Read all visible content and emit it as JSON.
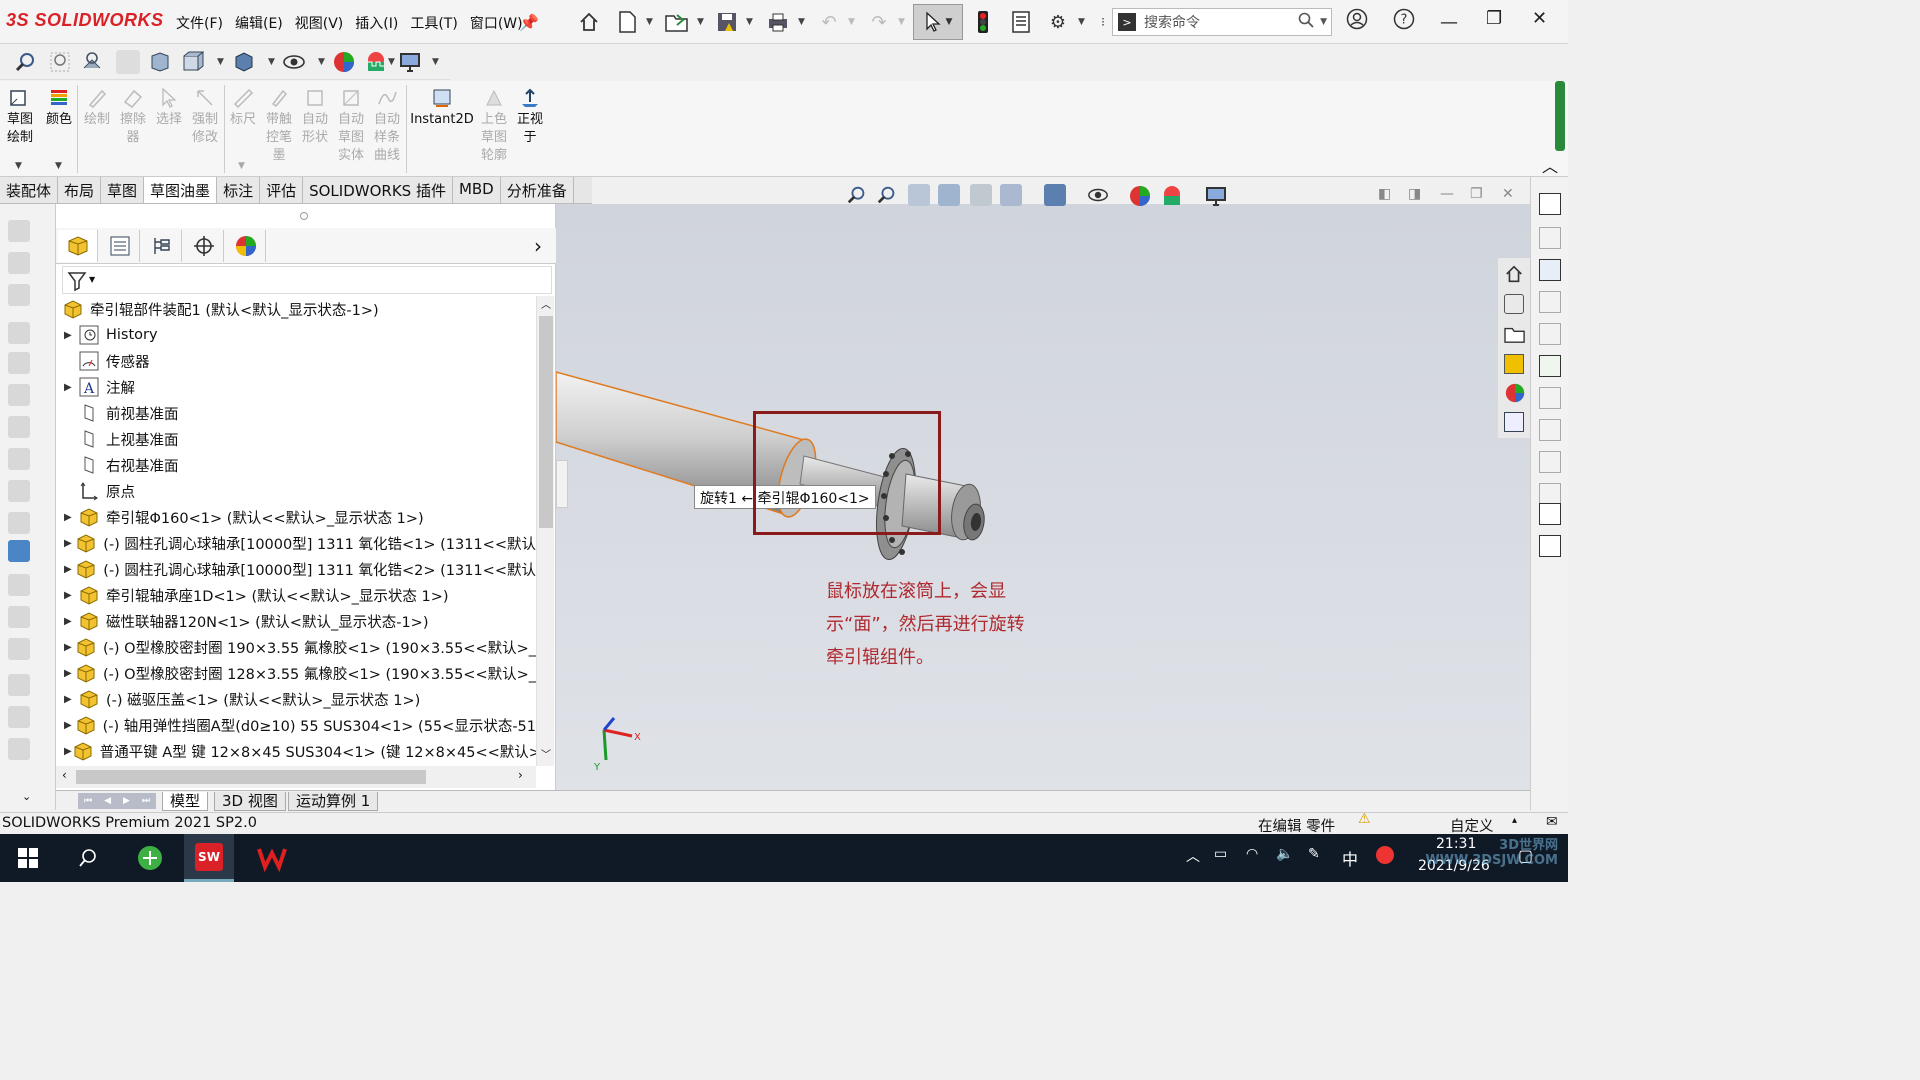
{
  "app": {
    "logo": "3S SOLIDWORKS",
    "brand_color": "#da2128"
  },
  "menu": [
    "文件(F)",
    "编辑(E)",
    "视图(V)",
    "插入(I)",
    "工具(T)",
    "窗口(W)"
  ],
  "search": {
    "placeholder": "搜索命令"
  },
  "command_manager": {
    "items": [
      {
        "label": "草图\n绘制",
        "enabled": true
      },
      {
        "label": "颜色",
        "enabled": true
      },
      {
        "label": "绘制",
        "enabled": false
      },
      {
        "label": "擦除\n器",
        "enabled": false
      },
      {
        "label": "选择",
        "enabled": false
      },
      {
        "label": "强制\n修改",
        "enabled": false
      },
      {
        "label": "标尺",
        "enabled": false
      },
      {
        "label": "带触\n控笔\n墨",
        "enabled": false
      },
      {
        "label": "自动\n形状",
        "enabled": false
      },
      {
        "label": "自动\n草图\n实体",
        "enabled": false
      },
      {
        "label": "自动\n样条\n曲线",
        "enabled": false
      },
      {
        "label": "Instant2D",
        "enabled": true
      },
      {
        "label": "上色\n草图\n轮廓",
        "enabled": false
      },
      {
        "label": "正视\n于",
        "enabled": true
      }
    ]
  },
  "tabs": [
    "装配体",
    "布局",
    "草图",
    "草图油墨",
    "标注",
    "评估",
    "SOLIDWORKS 插件",
    "MBD",
    "分析准备"
  ],
  "active_tab": "草图油墨",
  "feature_tree": {
    "root": "牵引辊部件装配1 (默认<默认_显示状态-1>)",
    "items": [
      {
        "label": "History",
        "expandable": true,
        "icon": "history-icon"
      },
      {
        "label": "传感器",
        "expandable": false,
        "icon": "sensor-icon"
      },
      {
        "label": "注解",
        "expandable": true,
        "icon": "annotation-icon"
      },
      {
        "label": "前视基准面",
        "expandable": false,
        "icon": "plane-icon"
      },
      {
        "label": "上视基准面",
        "expandable": false,
        "icon": "plane-icon"
      },
      {
        "label": "右视基准面",
        "expandable": false,
        "icon": "plane-icon"
      },
      {
        "label": "原点",
        "expandable": false,
        "icon": "origin-icon"
      },
      {
        "label": "牵引辊Φ160<1> (默认<<默认>_显示状态 1>)",
        "expandable": true,
        "icon": "part-icon"
      },
      {
        "label": "(-) 圆柱孔调心球轴承[10000型] 1311 氧化锆<1> (1311<<默认",
        "expandable": true,
        "icon": "part-icon"
      },
      {
        "label": "(-) 圆柱孔调心球轴承[10000型] 1311 氧化锆<2> (1311<<默认",
        "expandable": true,
        "icon": "part-icon"
      },
      {
        "label": "牵引辊轴承座1D<1> (默认<<默认>_显示状态 1>)",
        "expandable": true,
        "icon": "part-icon"
      },
      {
        "label": "磁性联轴器120N<1> (默认<默认_显示状态-1>)",
        "expandable": true,
        "icon": "part-icon"
      },
      {
        "label": "(-) O型橡胶密封圈 190×3.55 氟橡胶<1> (190×3.55<<默认>_",
        "expandable": true,
        "icon": "part-icon"
      },
      {
        "label": "(-) O型橡胶密封圈 128×3.55 氟橡胶<1> (190×3.55<<默认>_",
        "expandable": true,
        "icon": "part-icon"
      },
      {
        "label": "(-) 磁驱压盖<1> (默认<<默认>_显示状态 1>)",
        "expandable": true,
        "icon": "part-icon"
      },
      {
        "label": "(-) 轴用弹性挡圈A型(d0≥10) 55 SUS304<1> (55<显示状态-51",
        "expandable": true,
        "icon": "part-icon"
      },
      {
        "label": "普通平键 A型 键 12×8×45 SUS304<1> (键 12×8×45<<默认>",
        "expandable": true,
        "icon": "part-icon"
      }
    ]
  },
  "viewport": {
    "tooltip": "旋转1 ← 牵引辊Φ160<1>",
    "annotation": "鼠标放在滚筒上，会显示“面”，然后再进行旋转牵引辊组件。",
    "annotation_color": "#b0282f",
    "triad": {
      "x": "X",
      "y": "Y"
    }
  },
  "bottom_tabs": [
    "模型",
    "3D 视图",
    "运动算例 1"
  ],
  "status": {
    "version": "SOLIDWORKS Premium 2021 SP2.0",
    "mode": "在编辑 零件",
    "custom": "自定义"
  },
  "taskbar": {
    "time": "21:31",
    "date": "2021/9/26",
    "ime": "中",
    "watermark": "3D世界网 WWW.3DSJW.COM"
  }
}
